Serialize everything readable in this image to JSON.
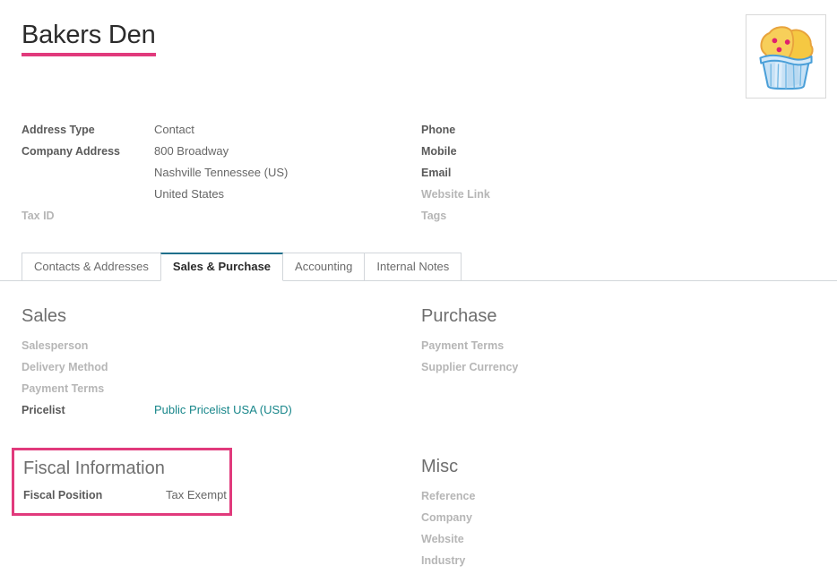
{
  "record": {
    "title": "Bakers Den",
    "title_underline_color": "#e13a7c",
    "avatar_alt": "cupcake-logo"
  },
  "header_fields": {
    "left": [
      {
        "label": "Address Type",
        "value": "Contact",
        "muted": false
      },
      {
        "label": "Company Address",
        "value": "800 Broadway",
        "muted": false
      },
      {
        "label": "",
        "value": "Nashville  Tennessee (US)",
        "muted": false
      },
      {
        "label": "",
        "value": "United States",
        "muted": false
      },
      {
        "label": "Tax ID",
        "value": "",
        "muted": true
      }
    ],
    "right": [
      {
        "label": "Phone",
        "value": "",
        "muted": false
      },
      {
        "label": "Mobile",
        "value": "",
        "muted": false
      },
      {
        "label": "Email",
        "value": "",
        "muted": false
      },
      {
        "label": "Website Link",
        "value": "",
        "muted": true
      },
      {
        "label": "Tags",
        "value": "",
        "muted": true
      }
    ]
  },
  "notebook": {
    "tabs": [
      {
        "label": "Contacts & Addresses",
        "active": false
      },
      {
        "label": "Sales & Purchase",
        "active": true
      },
      {
        "label": "Accounting",
        "active": false
      },
      {
        "label": "Internal Notes",
        "active": false
      }
    ],
    "active_tab_border_color": "#1f6f8b"
  },
  "sales_purchase": {
    "sales": {
      "title": "Sales",
      "rows": [
        {
          "label": "Salesperson",
          "value": "",
          "muted": true,
          "link": false
        },
        {
          "label": "Delivery Method",
          "value": "",
          "muted": true,
          "link": false
        },
        {
          "label": "Payment Terms",
          "value": "",
          "muted": true,
          "link": false
        },
        {
          "label": "Pricelist",
          "value": "Public Pricelist USA (USD)",
          "muted": false,
          "link": true
        }
      ]
    },
    "purchase": {
      "title": "Purchase",
      "rows": [
        {
          "label": "Payment Terms",
          "value": "",
          "muted": true,
          "link": false
        },
        {
          "label": "Supplier Currency",
          "value": "",
          "muted": true,
          "link": false
        }
      ]
    },
    "fiscal_information": {
      "title": "Fiscal Information",
      "highlight_color": "#e13a7c",
      "rows": [
        {
          "label": "Fiscal Position",
          "value": "Tax Exempt",
          "muted": false,
          "link": false
        }
      ]
    },
    "misc": {
      "title": "Misc",
      "rows": [
        {
          "label": "Reference",
          "value": "",
          "muted": true,
          "link": false
        },
        {
          "label": "Company",
          "value": "",
          "muted": true,
          "link": false
        },
        {
          "label": "Website",
          "value": "",
          "muted": true,
          "link": false
        },
        {
          "label": "Industry",
          "value": "",
          "muted": true,
          "link": false
        }
      ]
    }
  },
  "colors": {
    "link": "#17868a",
    "accent_pink": "#e13a7c",
    "tab_active": "#1f6f8b",
    "muted_label": "#b6b6b6"
  }
}
